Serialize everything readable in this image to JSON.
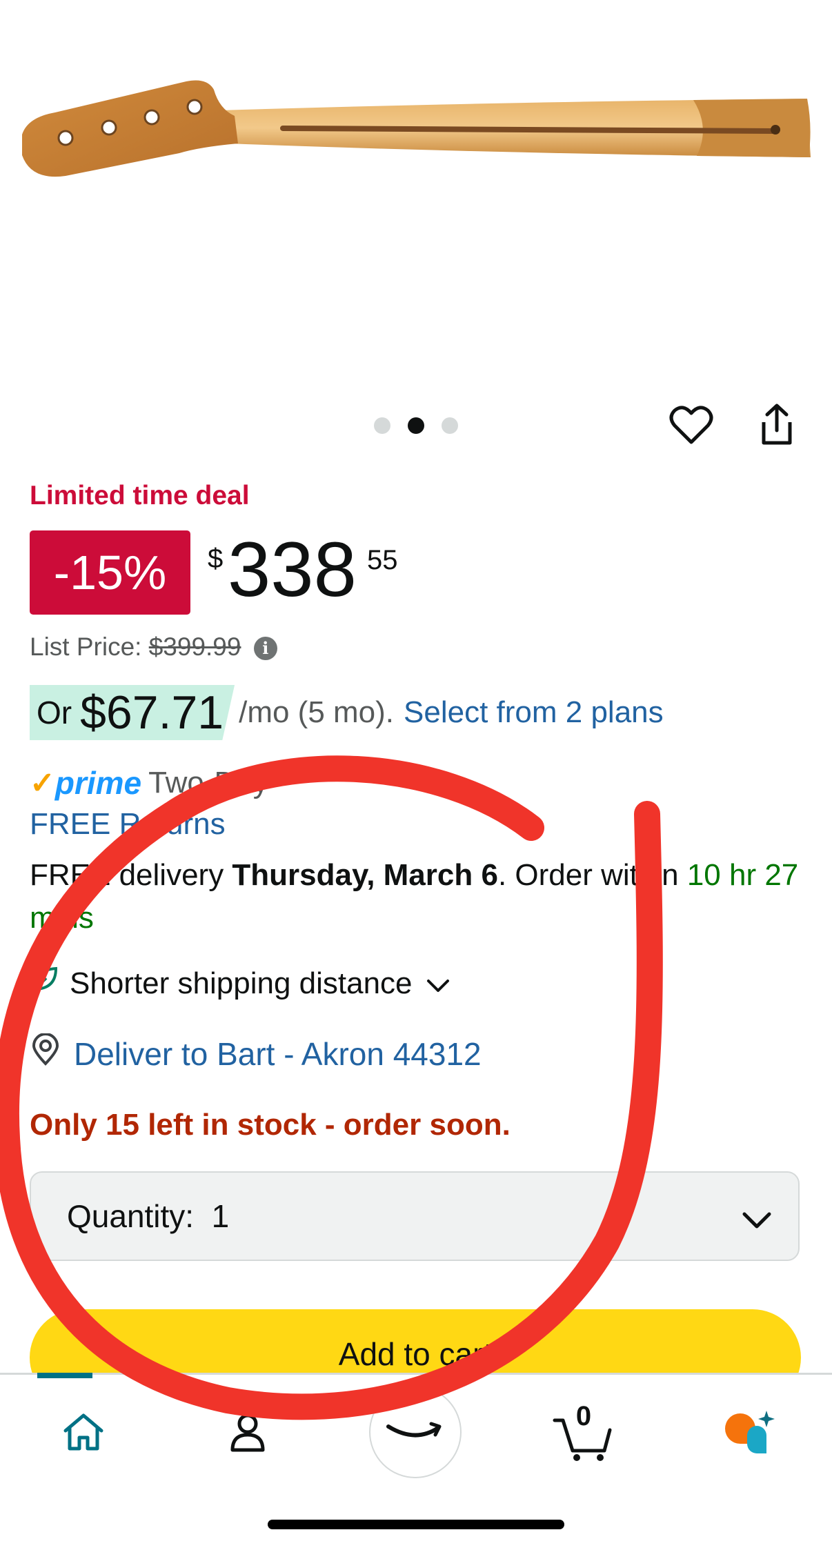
{
  "gallery": {
    "image_alt": "Maple bass guitar neck",
    "dots": [
      false,
      true,
      false
    ]
  },
  "actions": {
    "wishlist_icon": "heart-icon",
    "share_icon": "share-icon"
  },
  "deal": {
    "label": "Limited time deal",
    "discount": "-15%",
    "currency": "$",
    "price_whole": "338",
    "price_fraction": "55",
    "list_price_label": "List Price:",
    "list_price": "$399.99"
  },
  "installment": {
    "or": "Or",
    "amount": "$67.71",
    "suffix": "/mo (5 mo).",
    "link": "Select from 2 plans"
  },
  "prime": {
    "check": "✓",
    "word": "prime",
    "text": "Two-Day",
    "returns": "FREE Returns"
  },
  "delivery": {
    "prefix": "FREE delivery ",
    "date": "Thursday, March 6",
    "middle": ". Order within ",
    "countdown": "10 hr 27 mins"
  },
  "shipping_note": "Shorter shipping distance",
  "deliver_to": "Deliver to Bart - Akron 44312",
  "stock": "Only 15 left in stock - order soon.",
  "quantity": {
    "label": "Quantity:",
    "value": "1"
  },
  "add_to_cart": "Add to cart",
  "tab_bar": {
    "cart_count": "0"
  },
  "colors": {
    "deal_red": "#cc0c39",
    "link_blue": "#2162a1",
    "stock_red": "#b12704",
    "button_yellow": "#ffd814",
    "annotation_red": "#f0342a"
  }
}
